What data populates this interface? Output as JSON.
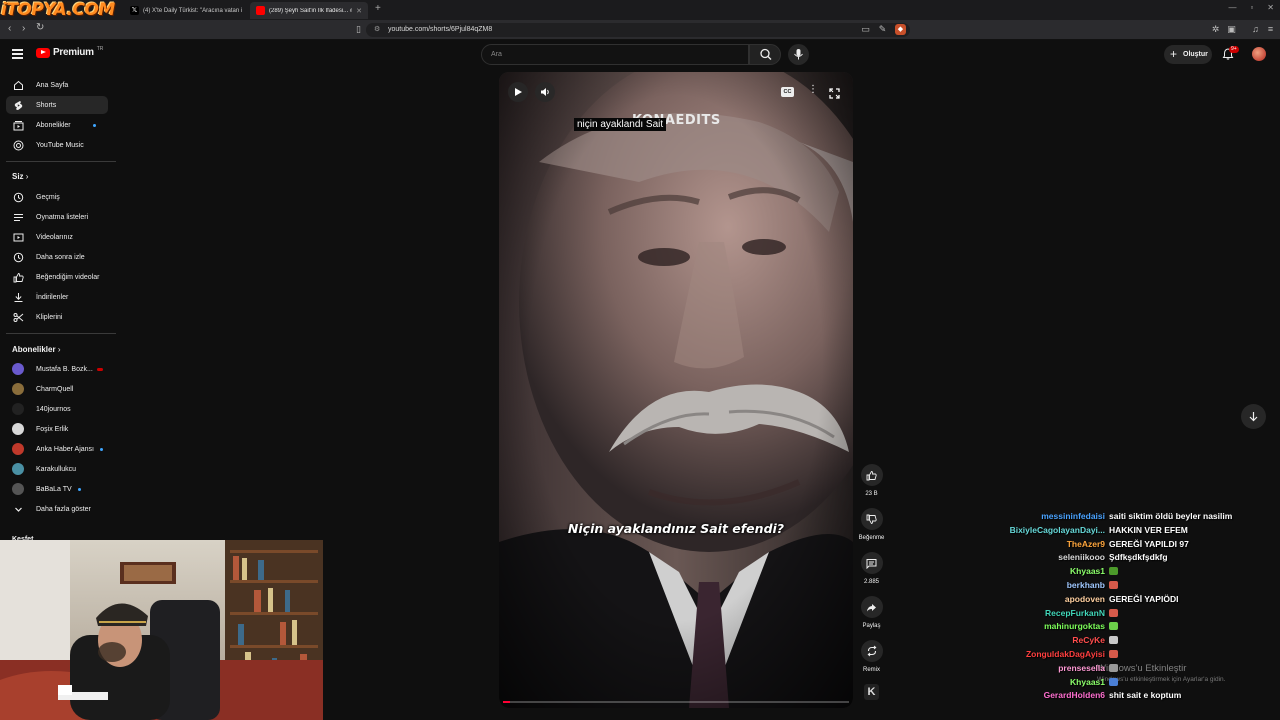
{
  "browser": {
    "overlay_logo": "iTOPYA.COM",
    "tabs": [
      {
        "title": "(4) X'te Daily Türkist: \"Aracına vatan i",
        "active": false
      },
      {
        "title": "(289) Şeyh Sait'in İlk İfadesi... #...",
        "active": true
      }
    ],
    "new_tab": "+",
    "url": "youtube.com/shorts/6Pjul84qZM8"
  },
  "header": {
    "logo_word": "Premium",
    "logo_country": "TR",
    "search_placeholder": "Ara",
    "create_label": "Oluştur",
    "notification_badge": "9+"
  },
  "sidebar": {
    "main": [
      {
        "label": "Ana Sayfa",
        "icon": "home-icon"
      },
      {
        "label": "Shorts",
        "icon": "shorts-icon",
        "selected": true
      },
      {
        "label": "Abonelikler",
        "icon": "subscriptions-icon",
        "dot": true
      },
      {
        "label": "YouTube Music",
        "icon": "music-icon"
      }
    ],
    "you_header": "Siz",
    "you": [
      {
        "label": "Geçmiş",
        "icon": "history-icon"
      },
      {
        "label": "Oynatma listeleri",
        "icon": "playlist-icon"
      },
      {
        "label": "Videolarınız",
        "icon": "your-videos-icon"
      },
      {
        "label": "Daha sonra izle",
        "icon": "watch-later-icon"
      },
      {
        "label": "Beğendiğim videolar",
        "icon": "liked-icon"
      },
      {
        "label": "İndirilenler",
        "icon": "download-icon"
      },
      {
        "label": "Kliplerini",
        "icon": "clip-icon"
      }
    ],
    "subs_header": "Abonelikler",
    "subs": [
      {
        "label": "Mustafa B. Bozk...",
        "color": "#6a5acd",
        "live": true
      },
      {
        "label": "CharmQuell",
        "color": "#8a6d3b"
      },
      {
        "label": "140journos",
        "color": "#222222"
      },
      {
        "label": "Foşix Erlik",
        "color": "#d9d9d9"
      },
      {
        "label": "Anka Haber Ajansı",
        "color": "#c0392b",
        "dot": true
      },
      {
        "label": "Karakullukcu",
        "color": "#4a90a4"
      },
      {
        "label": "BaBaLa TV",
        "color": "#555555",
        "dot": true
      }
    ],
    "show_more": "Daha fazla göster",
    "cut_header": "Keşfet"
  },
  "player": {
    "top_caption": "niçin ayaklandı Sait",
    "watermark": "KONAEDITS",
    "subtitle": "Niçin ayaklandınız Sait efendi?",
    "progress": 0.02
  },
  "actions": [
    {
      "name": "like",
      "label": "23 B",
      "icon": "thumbs-up-icon"
    },
    {
      "name": "dislike",
      "label": "Beğenme",
      "icon": "thumbs-down-icon"
    },
    {
      "name": "comments",
      "label": "2.885",
      "icon": "comment-icon"
    },
    {
      "name": "share",
      "label": "Paylaş",
      "icon": "share-icon"
    },
    {
      "name": "remix",
      "label": "Remix",
      "icon": "remix-icon"
    }
  ],
  "channel_badge": "K",
  "chat": [
    {
      "user": "messininfedaisi",
      "color": "#4aa3ff",
      "text": "saiti siktim öldü beyler nasilim"
    },
    {
      "user": "BixiyleCagolayanDayi...",
      "color": "#67d9d9",
      "text": "HAKKIN VER EFEM"
    },
    {
      "user": "TheAzer9",
      "color": "#ffa63d",
      "text": "GEREĞİ YAPILDI 97"
    },
    {
      "user": "seleniikooo",
      "color": "#d9d9d9",
      "text": "Şdfkşdkfşdkfg"
    },
    {
      "user": "Khyaas1",
      "color": "#8cff6b",
      "text": "",
      "emote": "#4c9a2a"
    },
    {
      "user": "berkhanb",
      "color": "#a0c8ff",
      "text": "",
      "emote": "#d65a4a"
    },
    {
      "user": "apodoven",
      "color": "#ffd0a0",
      "text": "GEREĞİ YAPIÖDI"
    },
    {
      "user": "RecepFurkanN",
      "color": "#41d6b9",
      "text": "",
      "emote": "#d65a4a"
    },
    {
      "user": "mahinurgoktas",
      "color": "#7dff5a",
      "text": "",
      "emote": "#6cd04a"
    },
    {
      "user": "ReCyKe",
      "color": "#ff4d4d",
      "text": "",
      "emote": "#c9c9c9"
    },
    {
      "user": "ZonguldakDagAyisi",
      "color": "#ff3f3f",
      "text": "",
      "emote": "#d65a4a"
    },
    {
      "user": "prensesella",
      "color": "#ff9ad5",
      "text": "",
      "emote": "#999999"
    },
    {
      "user": "Khyaas1",
      "color": "#8cff6b",
      "text": "",
      "emote": "#4a7fd6"
    },
    {
      "user": "GerardHolden6",
      "color": "#ff6fd0",
      "text": "shit sait e koptum"
    }
  ],
  "windows_notice": {
    "title": "Windows'u Etkinleştir",
    "sub": "Windows'u etkinleştirmek için Ayarlar'a gidin."
  }
}
